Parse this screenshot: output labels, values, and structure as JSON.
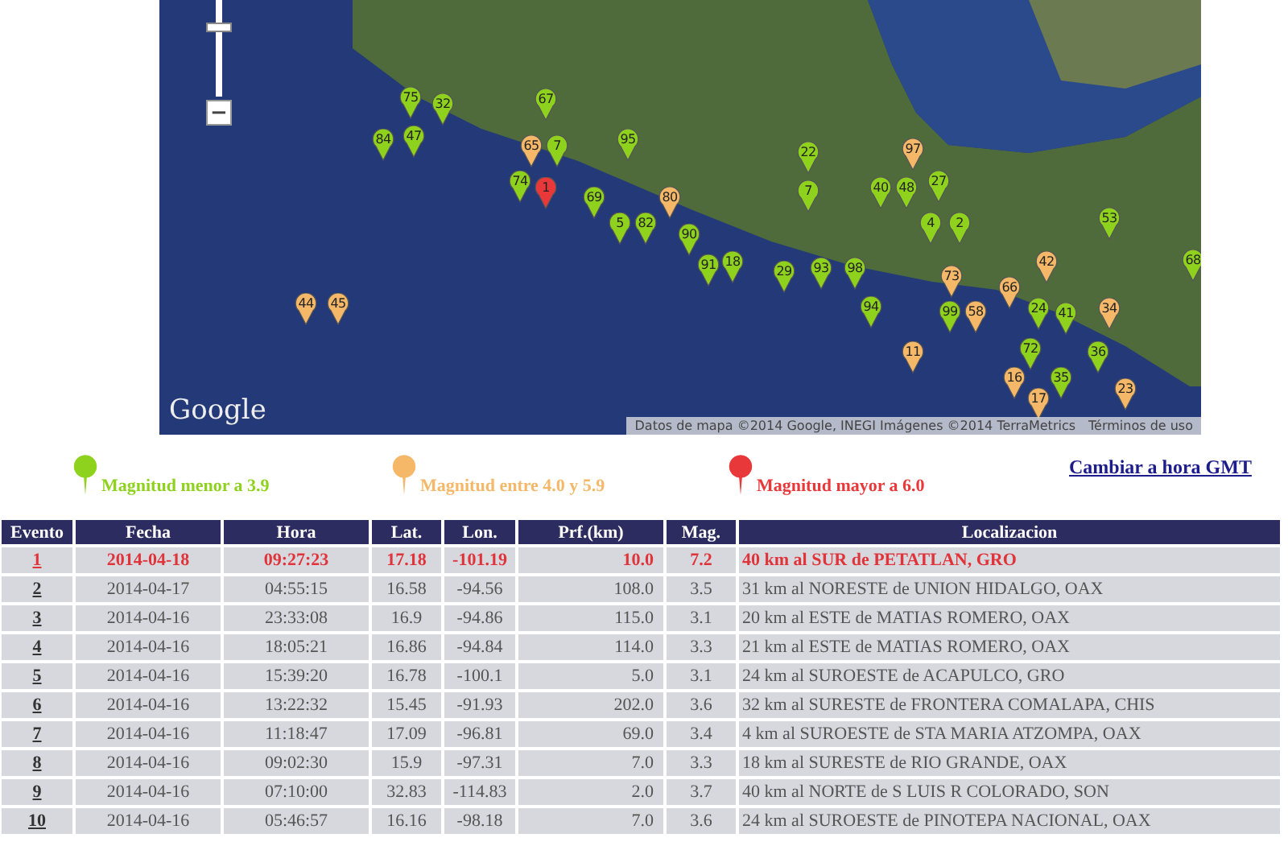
{
  "map": {
    "zoom_out": "−",
    "logo": "Google",
    "attribution": "Datos de mapa ©2014 Google, INEGI Imágenes ©2014 TerraMetrics",
    "terms": "Términos de uso",
    "zoom_slider": {
      "level": 0.75
    },
    "markers": [
      {
        "label": "75",
        "color": "#8fd21e"
      },
      {
        "label": "32",
        "color": "#8fd21e"
      },
      {
        "label": "67",
        "color": "#8fd21e"
      },
      {
        "label": "84",
        "color": "#8fd21e"
      },
      {
        "label": "47",
        "color": "#8fd21e"
      },
      {
        "label": "65",
        "color": "#f4b868"
      },
      {
        "label": "7",
        "color": "#8fd21e"
      },
      {
        "label": "95",
        "color": "#8fd21e"
      },
      {
        "label": "22",
        "color": "#8fd21e"
      },
      {
        "label": "97",
        "color": "#f4b868"
      },
      {
        "label": "74",
        "color": "#8fd21e"
      },
      {
        "label": "1",
        "color": "#e8383a"
      },
      {
        "label": "69",
        "color": "#8fd21e"
      },
      {
        "label": "80",
        "color": "#f4b868"
      },
      {
        "label": "7",
        "color": "#8fd21e"
      },
      {
        "label": "40",
        "color": "#8fd21e"
      },
      {
        "label": "48",
        "color": "#8fd21e"
      },
      {
        "label": "27",
        "color": "#8fd21e"
      },
      {
        "label": "5",
        "color": "#8fd21e"
      },
      {
        "label": "82",
        "color": "#8fd21e"
      },
      {
        "label": "90",
        "color": "#8fd21e"
      },
      {
        "label": "4",
        "color": "#8fd21e"
      },
      {
        "label": "2",
        "color": "#8fd21e"
      },
      {
        "label": "53",
        "color": "#8fd21e"
      },
      {
        "label": "91",
        "color": "#8fd21e"
      },
      {
        "label": "18",
        "color": "#8fd21e"
      },
      {
        "label": "29",
        "color": "#8fd21e"
      },
      {
        "label": "93",
        "color": "#8fd21e"
      },
      {
        "label": "98",
        "color": "#8fd21e"
      },
      {
        "label": "73",
        "color": "#f4b868"
      },
      {
        "label": "66",
        "color": "#f4b868"
      },
      {
        "label": "42",
        "color": "#f4b868"
      },
      {
        "label": "68",
        "color": "#8fd21e"
      },
      {
        "label": "44",
        "color": "#f4b868"
      },
      {
        "label": "45",
        "color": "#f4b868"
      },
      {
        "label": "94",
        "color": "#8fd21e"
      },
      {
        "label": "99",
        "color": "#8fd21e"
      },
      {
        "label": "58",
        "color": "#f4b868"
      },
      {
        "label": "24",
        "color": "#8fd21e"
      },
      {
        "label": "41",
        "color": "#8fd21e"
      },
      {
        "label": "34",
        "color": "#f4b868"
      },
      {
        "label": "11",
        "color": "#f4b868"
      },
      {
        "label": "72",
        "color": "#8fd21e"
      },
      {
        "label": "36",
        "color": "#8fd21e"
      },
      {
        "label": "16",
        "color": "#f4b868"
      },
      {
        "label": "35",
        "color": "#8fd21e"
      },
      {
        "label": "23",
        "color": "#f4b868"
      },
      {
        "label": "17",
        "color": "#f4b868"
      }
    ]
  },
  "legend": [
    {
      "label": "Magnitud menor a 3.9",
      "color": "#8fd21e"
    },
    {
      "label": "Magnitud entre 4.0 y 5.9",
      "color": "#f4b868"
    },
    {
      "label": "Magnitud mayor a 6.0",
      "color": "#e8383a"
    }
  ],
  "gmt_link": "Cambiar a hora GMT",
  "table": {
    "columns": [
      "Evento",
      "Fecha",
      "Hora",
      "Lat.",
      "Lon.",
      "Prf.(km)",
      "Mag.",
      "Localizacion"
    ],
    "rows": [
      {
        "highlighted": true,
        "cells": [
          "1",
          "2014-04-18",
          "09:27:23",
          "17.18",
          "-101.19",
          "10.0",
          "7.2",
          "40 km al SUR de PETATLAN, GRO"
        ]
      },
      {
        "highlighted": false,
        "cells": [
          "2",
          "2014-04-17",
          "04:55:15",
          "16.58",
          "-94.56",
          "108.0",
          "3.5",
          "31 km al NORESTE de UNION HIDALGO, OAX"
        ]
      },
      {
        "highlighted": false,
        "cells": [
          "3",
          "2014-04-16",
          "23:33:08",
          "16.9",
          "-94.86",
          "115.0",
          "3.1",
          "20 km al ESTE de MATIAS ROMERO, OAX"
        ]
      },
      {
        "highlighted": false,
        "cells": [
          "4",
          "2014-04-16",
          "18:05:21",
          "16.86",
          "-94.84",
          "114.0",
          "3.3",
          "21 km al ESTE de MATIAS ROMERO, OAX"
        ]
      },
      {
        "highlighted": false,
        "cells": [
          "5",
          "2014-04-16",
          "15:39:20",
          "16.78",
          "-100.1",
          "5.0",
          "3.1",
          "24 km al SUROESTE de ACAPULCO, GRO"
        ]
      },
      {
        "highlighted": false,
        "cells": [
          "6",
          "2014-04-16",
          "13:22:32",
          "15.45",
          "-91.93",
          "202.0",
          "3.6",
          "32 km al SURESTE de FRONTERA COMALAPA, CHIS"
        ]
      },
      {
        "highlighted": false,
        "cells": [
          "7",
          "2014-04-16",
          "11:18:47",
          "17.09",
          "-96.81",
          "69.0",
          "3.4",
          "4 km al SUROESTE de STA MARIA ATZOMPA, OAX"
        ]
      },
      {
        "highlighted": false,
        "cells": [
          "8",
          "2014-04-16",
          "09:02:30",
          "15.9",
          "-97.31",
          "7.0",
          "3.3",
          "18 km al SURESTE de RIO GRANDE, OAX"
        ]
      },
      {
        "highlighted": false,
        "cells": [
          "9",
          "2014-04-16",
          "07:10:00",
          "32.83",
          "-114.83",
          "2.0",
          "3.7",
          "40 km al NORTE de S LUIS R COLORADO, SON"
        ]
      },
      {
        "highlighted": false,
        "cells": [
          "10",
          "2014-04-16",
          "05:46:57",
          "16.16",
          "-98.18",
          "7.0",
          "3.6",
          "24 km al SUROESTE de PINOTEPA NACIONAL, OAX"
        ]
      }
    ]
  }
}
